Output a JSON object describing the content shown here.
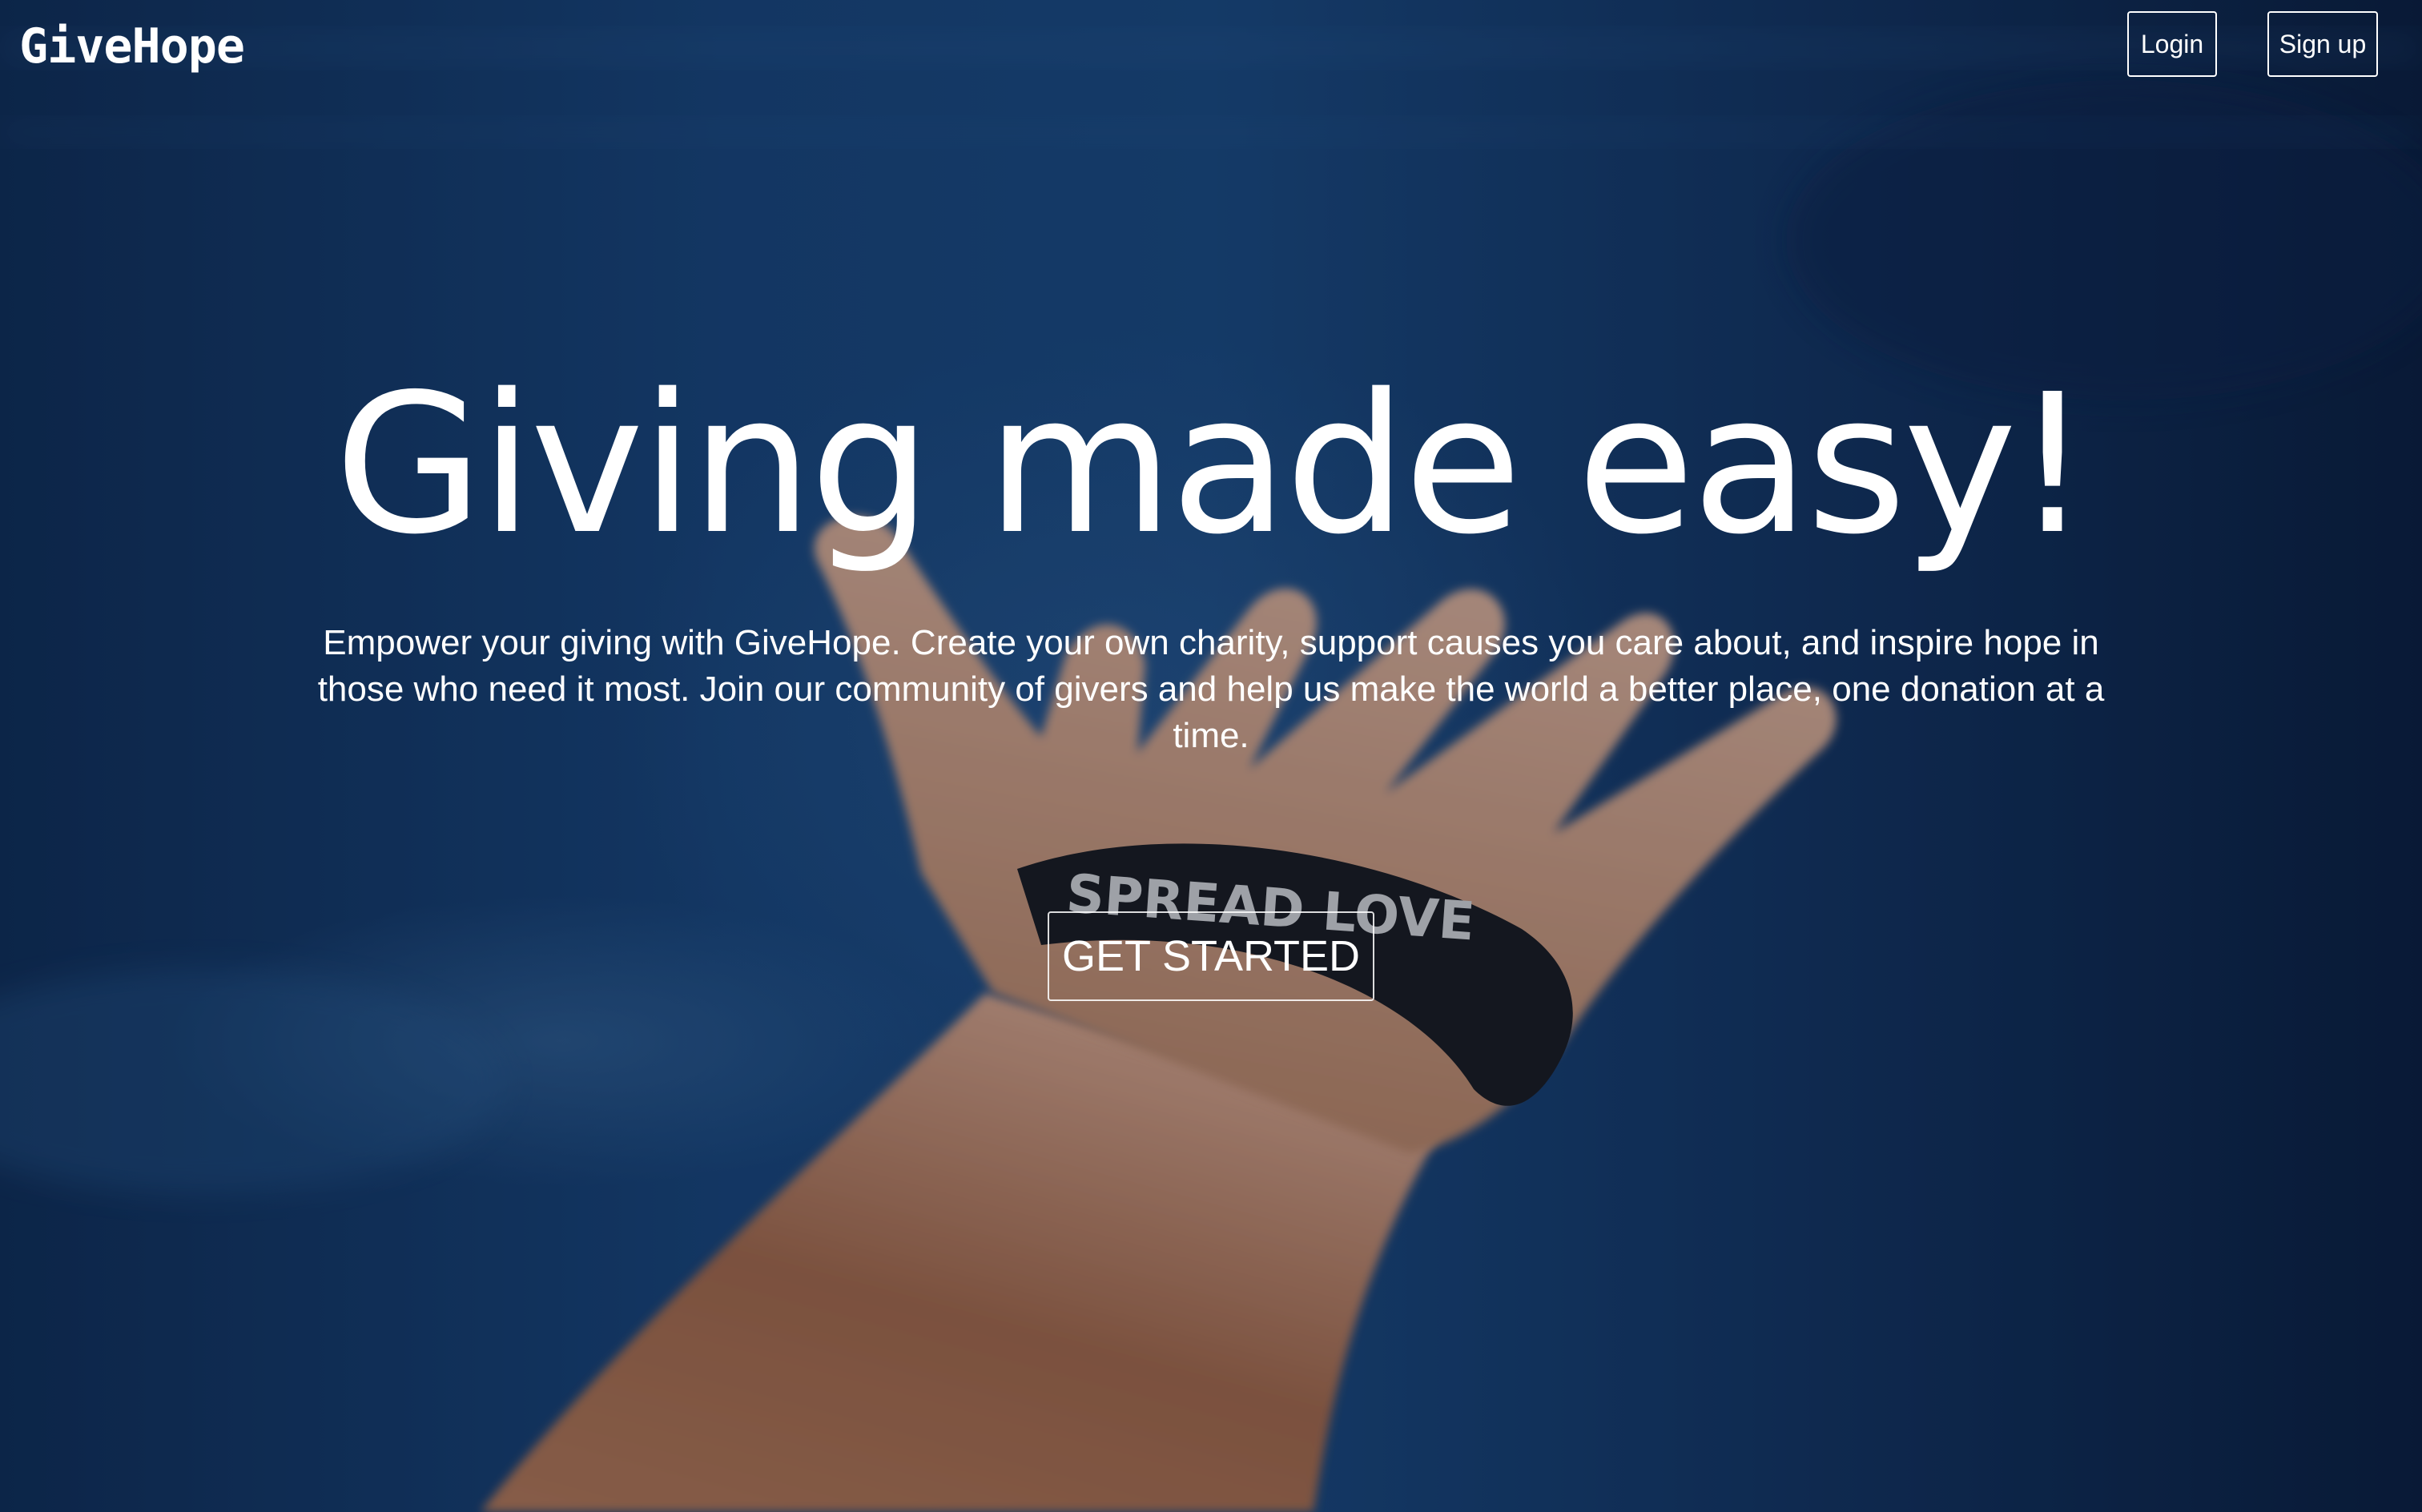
{
  "nav": {
    "brand": "GiveHope",
    "login_label": "Login",
    "signup_label": "Sign up"
  },
  "hero": {
    "title": "Giving made easy!",
    "subtitle": "Empower your giving with GiveHope. Create your own charity, support causes you care about, and inspire hope in those who need it most. Join our community of givers and help us make the world a better place, one donation at a time.",
    "cta_label": "GET STARTED",
    "background_image_alt": "Outstretched hand underwater wearing a wristband",
    "wristband_text": "SPREAD LOVE"
  },
  "colors": {
    "background_deep": "#0a1d3c",
    "background_mid": "#1a4a80",
    "text": "#ffffff"
  }
}
